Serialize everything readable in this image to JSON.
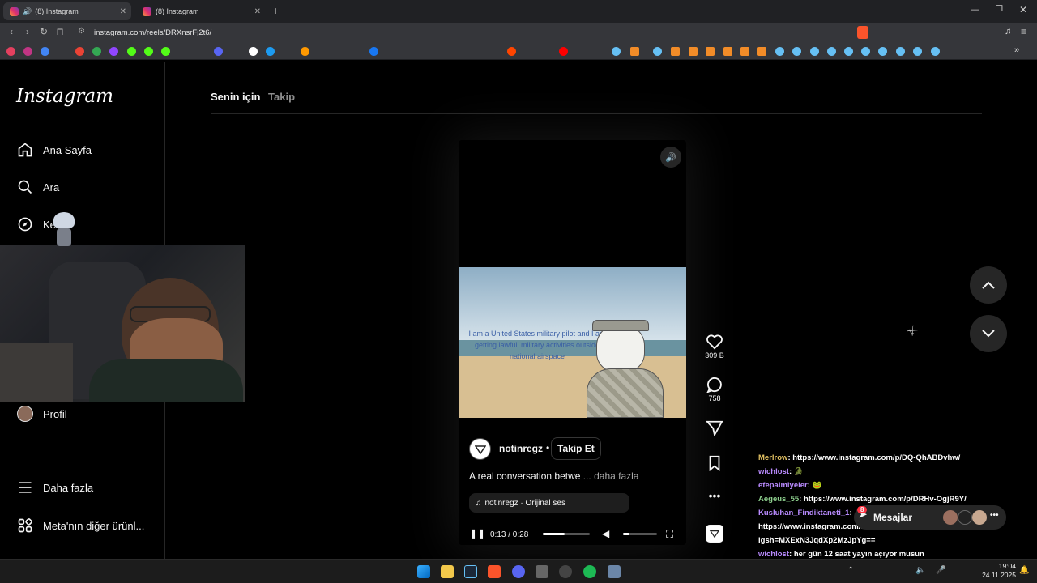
{
  "browser": {
    "tabs": [
      {
        "title": "(8) Instagram",
        "active": true
      },
      {
        "title": "(8) Instagram",
        "active": false
      }
    ],
    "new_tab_icon": "plus-icon",
    "url": "instagram.com/reels/DRXnsrFj2t6/",
    "window_controls": [
      "minimize-icon",
      "maximize-icon",
      "close-icon"
    ]
  },
  "sidebar": {
    "logo": "Instagram",
    "items": [
      {
        "label": "Ana Sayfa",
        "icon": "home-icon"
      },
      {
        "label": "Ara",
        "icon": "search-icon"
      },
      {
        "label": "Keşfet",
        "icon": "compass-icon"
      },
      {
        "label": "Profil",
        "icon": "avatar"
      },
      {
        "label": "Daha fazla",
        "icon": "menu-icon"
      },
      {
        "label": "Meta'nın diğer ürünl...",
        "icon": "grid-icon"
      }
    ]
  },
  "feed": {
    "tabs": [
      "Senin için",
      "Takip"
    ]
  },
  "reel": {
    "overlay_text": "I am a United States military pilot and I am getting lawfull military activities outside national airspace",
    "username": "notinregz",
    "follow_label": "Takip Et",
    "caption": "A real conversation betwe",
    "more_label": "... daha fazla",
    "audio": "notinregz · Orijinal ses",
    "time": "0:13 / 0:28",
    "progress": 0.46
  },
  "actions": {
    "likes": "309 B",
    "comments": "758"
  },
  "chat": {
    "lines": [
      {
        "user": "Merlrow",
        "text": ": https://www.instagram.com/p/DQ-QhABDvhw/"
      },
      {
        "user": "wichlost",
        "text": ":"
      },
      {
        "user": "efepalmiyeler",
        "text": ":"
      },
      {
        "user": "Aegeus_55",
        "text": ": https://www.instagram.com/p/DRHv-OgjR9Y/"
      },
      {
        "user": "Kusluhan_Findiktaneti_1",
        "text": ":"
      },
      {
        "user": "",
        "text": "https://www.instagram.com/reel/DRXnsrFj2t6/?"
      },
      {
        "user": "",
        "text": "igsh=MXExN3JqdXp2MzJpYg=="
      },
      {
        "user": "wichlost",
        "text": ": her gün 12 saat yayın açıyor musun"
      }
    ],
    "messages_label": "Mesajlar",
    "messages_badge": "8"
  },
  "taskbar": {
    "time": "19:04",
    "date": "24.11.2025"
  },
  "colors": {
    "bg": "#000000",
    "accent": "#0095f6",
    "chrome": "#35363a"
  }
}
